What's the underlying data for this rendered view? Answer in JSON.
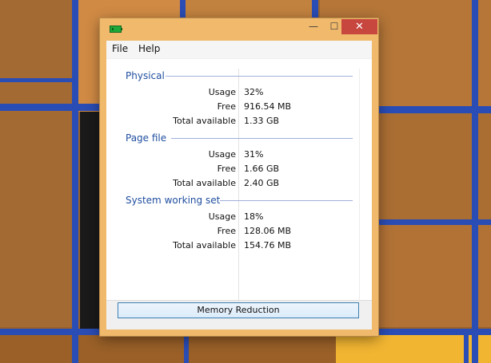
{
  "window": {
    "title": "",
    "buttons": {
      "minimize": "—",
      "maximize": "☐",
      "close": "✕"
    }
  },
  "menu": {
    "file": "File",
    "help": "Help"
  },
  "groups": [
    {
      "title": "Physical",
      "rows": [
        {
          "label": "Usage",
          "value": "32%"
        },
        {
          "label": "Free",
          "value": "916.54 MB"
        },
        {
          "label": "Total available",
          "value": "1.33 GB"
        }
      ]
    },
    {
      "title": "Page file",
      "rows": [
        {
          "label": "Usage",
          "value": "31%"
        },
        {
          "label": "Free",
          "value": "1.66 GB"
        },
        {
          "label": "Total available",
          "value": "2.40 GB"
        }
      ]
    },
    {
      "title": "System working set",
      "rows": [
        {
          "label": "Usage",
          "value": "18%"
        },
        {
          "label": "Free",
          "value": "128.06 MB"
        },
        {
          "label": "Total available",
          "value": "154.76 MB"
        }
      ]
    }
  ],
  "action_button": "Memory Reduction",
  "colors": {
    "window_border": "#f0b96c",
    "group_title": "#1f4e9f",
    "close": "#c7463e"
  },
  "icons": {
    "app": "memory-chip-icon"
  }
}
